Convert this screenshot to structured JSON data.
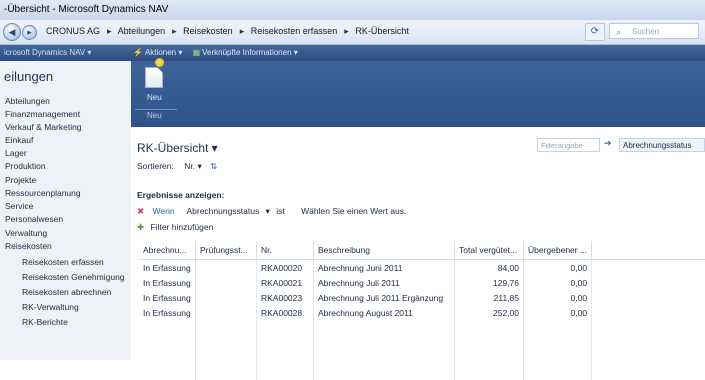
{
  "window": {
    "title": "-Übersicht - Microsoft Dynamics NAV"
  },
  "address": {
    "back_icon": "back-arrow",
    "forward_icon": "forward-arrow",
    "breadcrumbs": [
      "CRONUS AG",
      "Abteilungen",
      "Reisekosten",
      "Reisekosten erfassen",
      "RK-Übersicht"
    ],
    "search_placeholder": "Suchen"
  },
  "menubar": {
    "app_label": "icrosoft Dynamics NAV ▾",
    "actions_label": "Aktionen ▾",
    "related_label": "Verknüpfte Informationen ▾"
  },
  "sidebar": {
    "title": "eilungen",
    "items": [
      {
        "label": "Abteilungen",
        "level": 0
      },
      {
        "label": "Finanzmanagement",
        "level": 0
      },
      {
        "label": "Verkauf & Marketing",
        "level": 0
      },
      {
        "label": "Einkauf",
        "level": 0
      },
      {
        "label": "Lager",
        "level": 0
      },
      {
        "label": "Produktion",
        "level": 0
      },
      {
        "label": "Projekte",
        "level": 0
      },
      {
        "label": "Ressourcenplanung",
        "level": 0
      },
      {
        "label": "Service",
        "level": 0
      },
      {
        "label": "Personalwesen",
        "level": 0
      },
      {
        "label": "Verwaltung",
        "level": 0
      },
      {
        "label": "Reisekosten",
        "level": 0
      },
      {
        "label": "Reisekosten erfassen",
        "level": 1
      },
      {
        "label": "Reisekosten Genehmigung",
        "level": 1
      },
      {
        "label": "Reisekosten abrechnen",
        "level": 1
      },
      {
        "label": "RK-Verwaltung",
        "level": 1
      },
      {
        "label": "RK-Berichte",
        "level": 1
      }
    ]
  },
  "ribbon": {
    "new_label": "Neu",
    "group_label": "Neu"
  },
  "page": {
    "title": "RK-Übersicht ▾",
    "sort_label": "Sortieren:",
    "sort_value": "Nr. ▾",
    "sort_icon": "sort-ascending-icon",
    "filter_placeholder": "Filterangabe",
    "filter_field": "Abrechnungsstatus",
    "results_label": "Ergebnisse anzeigen:",
    "where_label": "Wenn",
    "where_field": "Abrechnungsstatus",
    "where_op": "ist",
    "where_value": "Wählen Sie einen Wert aus.",
    "add_filter_label": "Filter hinzufügen"
  },
  "table": {
    "columns": [
      "Abrechnu...",
      "Prüfungsst...",
      "Nr.",
      "Beschreibung",
      "Total vergütet...",
      "Übergebener ..."
    ],
    "rows": [
      [
        "In Erfassung",
        "",
        "RKA00020",
        "Abrechnung Juni 2011",
        "84,00",
        "0,00"
      ],
      [
        "In Erfassung",
        "",
        "RKA00021",
        "Abrechnung Juli 2011",
        "129,76",
        "0,00"
      ],
      [
        "In Erfassung",
        "",
        "RKA00023",
        "Abrechnung Juli 2011 Ergänzung",
        "211,85",
        "0,00"
      ],
      [
        "In Erfassung",
        "",
        "RKA00028",
        "Abrechnung August 2011",
        "252,00",
        "0,00"
      ]
    ]
  }
}
